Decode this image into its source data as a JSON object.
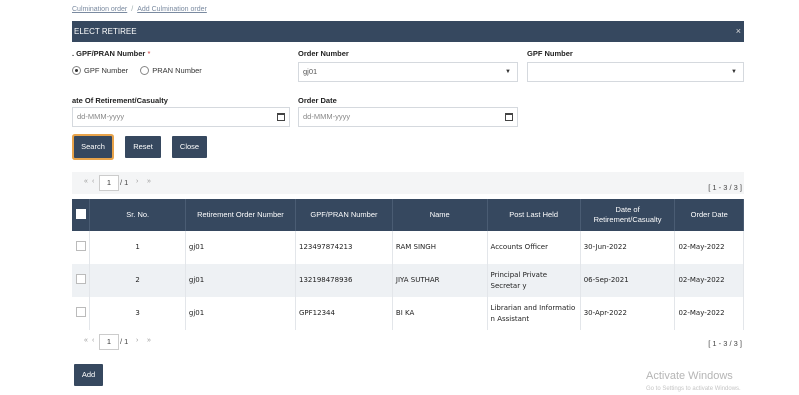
{
  "breadcrumb": {
    "items": [
      "Culmination order",
      "Add Culmination order"
    ]
  },
  "modal": {
    "title": "ELECT RETIREE",
    "close": "×"
  },
  "form": {
    "gpf_pran_label": ". GPF/PRAN Number",
    "required_mark": "*",
    "radio_gpf": "GPF Number",
    "radio_pran": "PRAN Number",
    "order_number_label": "Order Number",
    "order_number_value": "gj01",
    "gpf_number_label": "GPF Number",
    "gpf_number_value": "",
    "retirement_date_label": "ate Of Retirement/Casualty",
    "retirement_date_placeholder": "dd-MMM-yyyy",
    "order_date_label": "Order Date",
    "order_date_placeholder": "dd-MMM-yyyy"
  },
  "buttons": {
    "search": "Search",
    "reset": "Reset",
    "close": "Close",
    "add": "Add"
  },
  "pager": {
    "first": "«",
    "prev": "‹",
    "page": "1",
    "total": "/ 1",
    "next": "›",
    "last": "»",
    "range": "[ 1 - 3 / 3 ]"
  },
  "table": {
    "headers": [
      "",
      "Sr. No.",
      "Retirement Order Number",
      "GPF/PRAN Number",
      "Name",
      "Post Last Held",
      "Date of Retirement/Casualty",
      "Order Date"
    ],
    "rows": [
      {
        "sr": "1",
        "order": "gj01",
        "gpf": "123497874213",
        "name": "RAM SINGH",
        "post": "Accounts Officer",
        "retire_date": "30-Jun-2022",
        "order_date": "02-May-2022"
      },
      {
        "sr": "2",
        "order": "gj01",
        "gpf": "132198478936",
        "name": "JIYA SUTHAR",
        "post": "Principal Private Secretar y",
        "retire_date": "06-Sep-2021",
        "order_date": "02-May-2022"
      },
      {
        "sr": "3",
        "order": "gj01",
        "gpf": "GPF12344",
        "name": "BI KA",
        "post": "Librarian and Informatio n Assistant",
        "retire_date": "30-Apr-2022",
        "order_date": "02-May-2022"
      }
    ]
  },
  "watermark": {
    "title": "Activate Windows",
    "subtitle": "Go to Settings to activate Windows."
  }
}
